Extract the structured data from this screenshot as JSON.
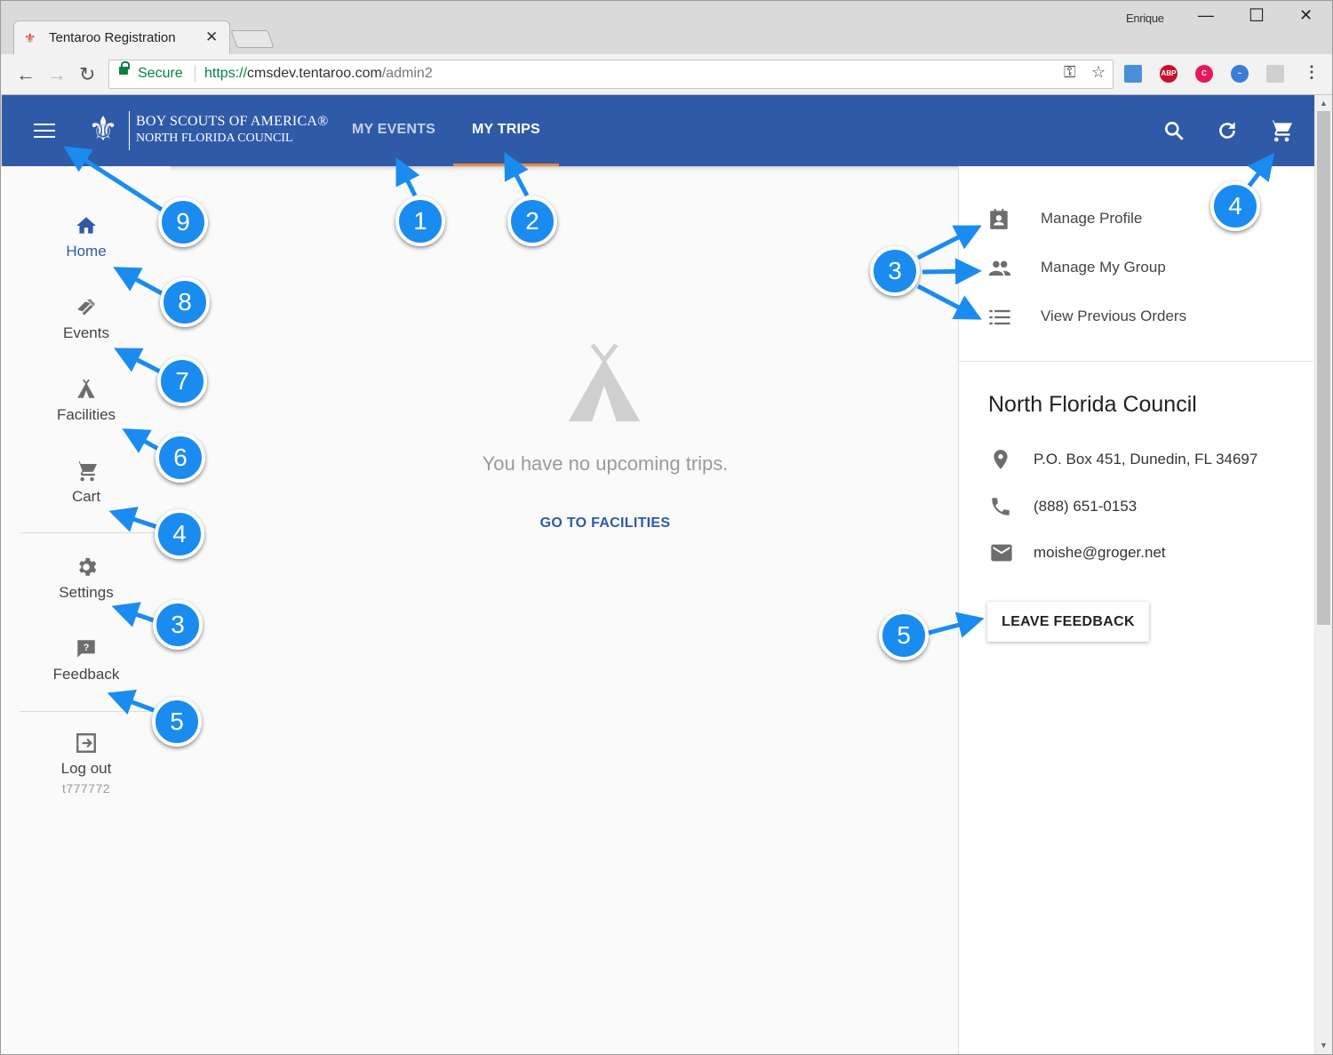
{
  "browser": {
    "tab_title": "Tentaroo Registration",
    "tab_close": "✕",
    "user_name": "Enrique",
    "secure_label": "Secure",
    "url_scheme": "https://",
    "url_host": "cmsdev.tentaroo.com",
    "url_path": "/admin2",
    "win_minimize": "—",
    "win_maximize": "☐",
    "win_close": "✕"
  },
  "header": {
    "logo_line1": "BOY SCOUTS OF AMERICA®",
    "logo_line2": "NORTH FLORIDA COUNCIL",
    "nav": [
      {
        "label": "MY EVENTS",
        "active": false
      },
      {
        "label": "MY TRIPS",
        "active": true
      }
    ],
    "accent_color": "#2f5aa8",
    "indicator_color": "#e88a3a"
  },
  "sidebar": {
    "items": [
      {
        "label": "Home",
        "icon": "home-icon",
        "active": true
      },
      {
        "label": "Events",
        "icon": "ticket-icon",
        "active": false
      },
      {
        "label": "Facilities",
        "icon": "tent-icon",
        "active": false
      },
      {
        "label": "Cart",
        "icon": "cart-icon",
        "active": false
      },
      {
        "label": "Settings",
        "icon": "gear-icon",
        "active": false
      },
      {
        "label": "Feedback",
        "icon": "feedback-icon",
        "active": false
      },
      {
        "label": "Log out",
        "icon": "logout-icon",
        "active": false
      }
    ],
    "logout_user": "t777772"
  },
  "main": {
    "empty_message": "You have no upcoming trips.",
    "go_link": "GO TO FACILITIES"
  },
  "right_panel": {
    "menu": [
      {
        "label": "Manage Profile",
        "icon": "profile-icon"
      },
      {
        "label": "Manage My Group",
        "icon": "group-icon"
      },
      {
        "label": "View Previous Orders",
        "icon": "list-icon"
      }
    ],
    "council_name": "North Florida Council",
    "address": "P.O. Box 451, Dunedin, FL 34697",
    "phone": "(888) 651-0153",
    "email": "moishe@groger.net",
    "feedback_button": "LEAVE FEEDBACK"
  },
  "callouts": [
    "1",
    "2",
    "3",
    "4",
    "5",
    "9",
    "8",
    "7",
    "6",
    "4",
    "3",
    "5"
  ],
  "callout_color": "#1a8cf0"
}
